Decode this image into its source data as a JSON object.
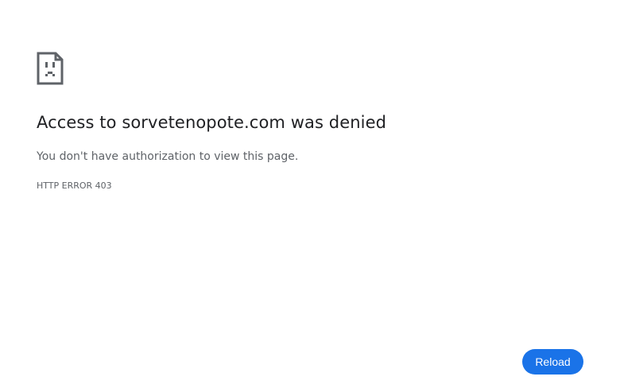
{
  "error": {
    "title": "Access to sorvetenopote.com was denied",
    "message": "You don't have authorization to view this page.",
    "code": "HTTP ERROR 403",
    "icon": "sad-page-icon"
  },
  "actions": {
    "reload_label": "Reload"
  },
  "colors": {
    "accent": "#1a73e8",
    "title_text": "#202124",
    "secondary_text": "#5f6368",
    "icon": "#5f6368"
  }
}
